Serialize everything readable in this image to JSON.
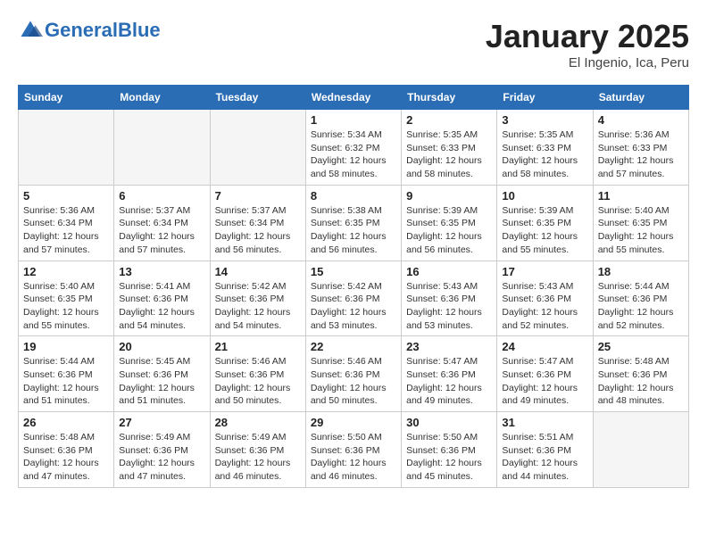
{
  "header": {
    "logo_general": "General",
    "logo_blue": "Blue",
    "month": "January 2025",
    "location": "El Ingenio, Ica, Peru"
  },
  "days_of_week": [
    "Sunday",
    "Monday",
    "Tuesday",
    "Wednesday",
    "Thursday",
    "Friday",
    "Saturday"
  ],
  "weeks": [
    [
      {
        "day": "",
        "info": ""
      },
      {
        "day": "",
        "info": ""
      },
      {
        "day": "",
        "info": ""
      },
      {
        "day": "1",
        "info": "Sunrise: 5:34 AM\nSunset: 6:32 PM\nDaylight: 12 hours\nand 58 minutes."
      },
      {
        "day": "2",
        "info": "Sunrise: 5:35 AM\nSunset: 6:33 PM\nDaylight: 12 hours\nand 58 minutes."
      },
      {
        "day": "3",
        "info": "Sunrise: 5:35 AM\nSunset: 6:33 PM\nDaylight: 12 hours\nand 58 minutes."
      },
      {
        "day": "4",
        "info": "Sunrise: 5:36 AM\nSunset: 6:33 PM\nDaylight: 12 hours\nand 57 minutes."
      }
    ],
    [
      {
        "day": "5",
        "info": "Sunrise: 5:36 AM\nSunset: 6:34 PM\nDaylight: 12 hours\nand 57 minutes."
      },
      {
        "day": "6",
        "info": "Sunrise: 5:37 AM\nSunset: 6:34 PM\nDaylight: 12 hours\nand 57 minutes."
      },
      {
        "day": "7",
        "info": "Sunrise: 5:37 AM\nSunset: 6:34 PM\nDaylight: 12 hours\nand 56 minutes."
      },
      {
        "day": "8",
        "info": "Sunrise: 5:38 AM\nSunset: 6:35 PM\nDaylight: 12 hours\nand 56 minutes."
      },
      {
        "day": "9",
        "info": "Sunrise: 5:39 AM\nSunset: 6:35 PM\nDaylight: 12 hours\nand 56 minutes."
      },
      {
        "day": "10",
        "info": "Sunrise: 5:39 AM\nSunset: 6:35 PM\nDaylight: 12 hours\nand 55 minutes."
      },
      {
        "day": "11",
        "info": "Sunrise: 5:40 AM\nSunset: 6:35 PM\nDaylight: 12 hours\nand 55 minutes."
      }
    ],
    [
      {
        "day": "12",
        "info": "Sunrise: 5:40 AM\nSunset: 6:35 PM\nDaylight: 12 hours\nand 55 minutes."
      },
      {
        "day": "13",
        "info": "Sunrise: 5:41 AM\nSunset: 6:36 PM\nDaylight: 12 hours\nand 54 minutes."
      },
      {
        "day": "14",
        "info": "Sunrise: 5:42 AM\nSunset: 6:36 PM\nDaylight: 12 hours\nand 54 minutes."
      },
      {
        "day": "15",
        "info": "Sunrise: 5:42 AM\nSunset: 6:36 PM\nDaylight: 12 hours\nand 53 minutes."
      },
      {
        "day": "16",
        "info": "Sunrise: 5:43 AM\nSunset: 6:36 PM\nDaylight: 12 hours\nand 53 minutes."
      },
      {
        "day": "17",
        "info": "Sunrise: 5:43 AM\nSunset: 6:36 PM\nDaylight: 12 hours\nand 52 minutes."
      },
      {
        "day": "18",
        "info": "Sunrise: 5:44 AM\nSunset: 6:36 PM\nDaylight: 12 hours\nand 52 minutes."
      }
    ],
    [
      {
        "day": "19",
        "info": "Sunrise: 5:44 AM\nSunset: 6:36 PM\nDaylight: 12 hours\nand 51 minutes."
      },
      {
        "day": "20",
        "info": "Sunrise: 5:45 AM\nSunset: 6:36 PM\nDaylight: 12 hours\nand 51 minutes."
      },
      {
        "day": "21",
        "info": "Sunrise: 5:46 AM\nSunset: 6:36 PM\nDaylight: 12 hours\nand 50 minutes."
      },
      {
        "day": "22",
        "info": "Sunrise: 5:46 AM\nSunset: 6:36 PM\nDaylight: 12 hours\nand 50 minutes."
      },
      {
        "day": "23",
        "info": "Sunrise: 5:47 AM\nSunset: 6:36 PM\nDaylight: 12 hours\nand 49 minutes."
      },
      {
        "day": "24",
        "info": "Sunrise: 5:47 AM\nSunset: 6:36 PM\nDaylight: 12 hours\nand 49 minutes."
      },
      {
        "day": "25",
        "info": "Sunrise: 5:48 AM\nSunset: 6:36 PM\nDaylight: 12 hours\nand 48 minutes."
      }
    ],
    [
      {
        "day": "26",
        "info": "Sunrise: 5:48 AM\nSunset: 6:36 PM\nDaylight: 12 hours\nand 47 minutes."
      },
      {
        "day": "27",
        "info": "Sunrise: 5:49 AM\nSunset: 6:36 PM\nDaylight: 12 hours\nand 47 minutes."
      },
      {
        "day": "28",
        "info": "Sunrise: 5:49 AM\nSunset: 6:36 PM\nDaylight: 12 hours\nand 46 minutes."
      },
      {
        "day": "29",
        "info": "Sunrise: 5:50 AM\nSunset: 6:36 PM\nDaylight: 12 hours\nand 46 minutes."
      },
      {
        "day": "30",
        "info": "Sunrise: 5:50 AM\nSunset: 6:36 PM\nDaylight: 12 hours\nand 45 minutes."
      },
      {
        "day": "31",
        "info": "Sunrise: 5:51 AM\nSunset: 6:36 PM\nDaylight: 12 hours\nand 44 minutes."
      },
      {
        "day": "",
        "info": ""
      }
    ]
  ]
}
